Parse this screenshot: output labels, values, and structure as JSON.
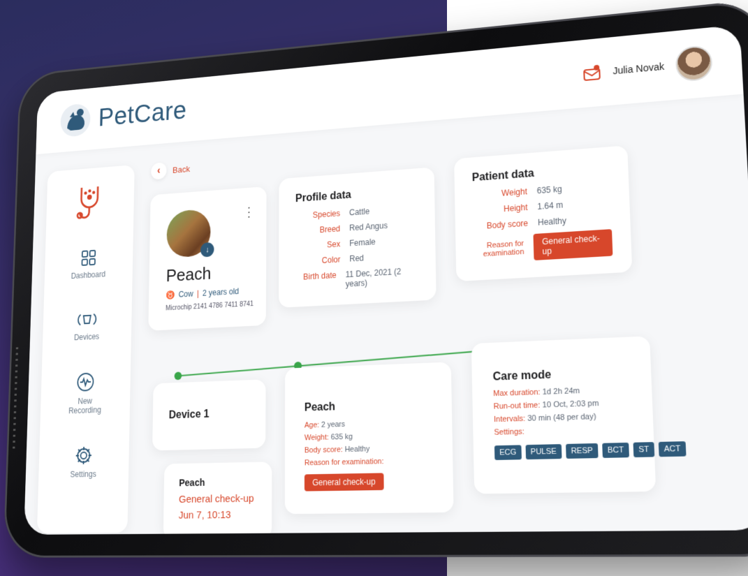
{
  "app": {
    "name": "PetCare"
  },
  "user": {
    "name": "Julia Novak"
  },
  "nav": [
    {
      "label": "Dashboard",
      "icon": "dashboard-icon"
    },
    {
      "label": "Devices",
      "icon": "devices-icon"
    },
    {
      "label": "New Recording",
      "icon": "recording-icon"
    },
    {
      "label": "Settings",
      "icon": "gear-icon"
    }
  ],
  "back_label": "Back",
  "pet": {
    "name": "Peach",
    "species_short": "Cow",
    "age": "2 years old",
    "microchip_label": "Microchip",
    "microchip": "2141 4786 7411 8741"
  },
  "profile": {
    "title": "Profile data",
    "rows": [
      {
        "k": "Species",
        "v": "Cattle"
      },
      {
        "k": "Breed",
        "v": "Red Angus"
      },
      {
        "k": "Sex",
        "v": "Female"
      },
      {
        "k": "Color",
        "v": "Red"
      },
      {
        "k": "Birth date",
        "v": "11 Dec, 2021 (2 years)"
      }
    ]
  },
  "patient": {
    "title": "Patient data",
    "rows": [
      {
        "k": "Weight",
        "v": "635 kg"
      },
      {
        "k": "Height",
        "v": "1.64 m"
      },
      {
        "k": "Body score",
        "v": "Healthy"
      }
    ],
    "reason_label": "Reason for examination",
    "reason_value": "General check-up"
  },
  "device": {
    "title": "Device 1"
  },
  "recording": {
    "pet": "Peach",
    "reason": "General check-up",
    "date": "Jun 7, 10:13"
  },
  "peach_card": {
    "title": "Peach",
    "rows": [
      {
        "k": "Age:",
        "v": "2 years"
      },
      {
        "k": "Weight:",
        "v": "635 kg"
      },
      {
        "k": "Body score:",
        "v": "Healthy"
      }
    ],
    "reason_label": "Reason for examination:",
    "reason_value": "General check-up"
  },
  "care_mode": {
    "title": "Care mode",
    "rows": [
      {
        "k": "Max duration:",
        "v": "1d 2h 24m"
      },
      {
        "k": "Run-out time:",
        "v": "10 Oct, 2:03 pm"
      },
      {
        "k": "Intervals:",
        "v": "30 min (48 per day)"
      }
    ],
    "settings_label": "Settings:",
    "tags": [
      "ECG",
      "PULSE",
      "RESP",
      "BCT",
      "ST",
      "ACT"
    ]
  },
  "colors": {
    "accent": "#d7472b",
    "brand": "#2f5a7a",
    "timeline": "#3aa64a"
  }
}
